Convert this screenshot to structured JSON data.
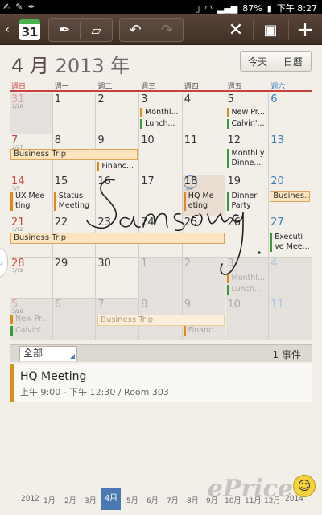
{
  "status": {
    "percent": "87%",
    "time": "下午 8:27"
  },
  "toolbar": {
    "calendar_day": "31"
  },
  "header": {
    "month": "4 月",
    "year": "2013 年",
    "today_btn": "今天",
    "agenda_btn": "日曆"
  },
  "weekdays": [
    "週日",
    "週一",
    "週二",
    "週三",
    "週四",
    "週五",
    "週六"
  ],
  "weeks": [
    [
      {
        "d": "31",
        "lunar": "2/20",
        "dim": true
      },
      {
        "d": "1"
      },
      {
        "d": "2"
      },
      {
        "d": "3"
      },
      {
        "d": "4"
      },
      {
        "d": "5"
      },
      {
        "d": "6"
      }
    ],
    [
      {
        "d": "7",
        "lunar": "2/27"
      },
      {
        "d": "8"
      },
      {
        "d": "9"
      },
      {
        "d": "10"
      },
      {
        "d": "11"
      },
      {
        "d": "12"
      },
      {
        "d": "13"
      }
    ],
    [
      {
        "d": "14",
        "lunar": "3/5"
      },
      {
        "d": "15"
      },
      {
        "d": "16"
      },
      {
        "d": "17"
      },
      {
        "d": "18",
        "lunar": "3/9"
      },
      {
        "d": "19"
      },
      {
        "d": "20"
      }
    ],
    [
      {
        "d": "21",
        "lunar": "3/12"
      },
      {
        "d": "22"
      },
      {
        "d": "23"
      },
      {
        "d": "24"
      },
      {
        "d": "25"
      },
      {
        "d": "26"
      },
      {
        "d": "27"
      }
    ],
    [
      {
        "d": "28",
        "lunar": "3/19"
      },
      {
        "d": "29"
      },
      {
        "d": "30"
      },
      {
        "d": "1",
        "dim": true
      },
      {
        "d": "2",
        "dim": true
      },
      {
        "d": "3",
        "dim": true
      },
      {
        "d": "4",
        "dim": true
      }
    ],
    [
      {
        "d": "5",
        "lunar": "3/26",
        "dim": true
      },
      {
        "d": "6",
        "dim": true
      },
      {
        "d": "7",
        "dim": true
      },
      {
        "d": "8",
        "dim": true
      },
      {
        "d": "9",
        "dim": true
      },
      {
        "d": "10",
        "dim": true
      },
      {
        "d": "11",
        "dim": true
      }
    ]
  ],
  "events": {
    "w0_thu_1": "Monthl...",
    "w0_thu_2": "Lunch...",
    "w0_sat_1": "New Pr...",
    "w0_sat_2": "Calvin'...",
    "w1_bar": "Business Trip",
    "w1_tue": "Financ...",
    "w1_sat": "Monthl y Dinne...",
    "w2_sun": "UX Mee ting",
    "w2_mon": "Status Meeting",
    "w2_thu": "HQ Me eting",
    "w2_fri": "Dinner Party",
    "w2_sat": "Busines...",
    "w3_bar": "Business Trip",
    "w3_sat": "Executi ve Mee...",
    "w4_fri_1": "Monthl...",
    "w4_fri_2": "Lunch...",
    "w5_sun_1": "New Pr...",
    "w5_sun_2": "Calvin'...",
    "w5_bar": "Business Trip",
    "w5_thu": "Financ..."
  },
  "filter": {
    "selected": "全部",
    "count": "1 事件"
  },
  "detail": {
    "title": "HQ Meeting",
    "subtitle": "上午 9:00 - 下午 12:30  / Room 303"
  },
  "months_strip": [
    "2012",
    "1月",
    "2月",
    "3月",
    "4月",
    "5月",
    "6月",
    "7月",
    "8月",
    "9月",
    "10月",
    "11月",
    "12月",
    "2014"
  ],
  "watermark": "ePrice",
  "colors": {
    "accent": "#e08a1c",
    "green": "#3a9a3a",
    "sunday": "#c8423d",
    "saturday": "#3a7cc2",
    "toolbar": "#4a382d"
  }
}
